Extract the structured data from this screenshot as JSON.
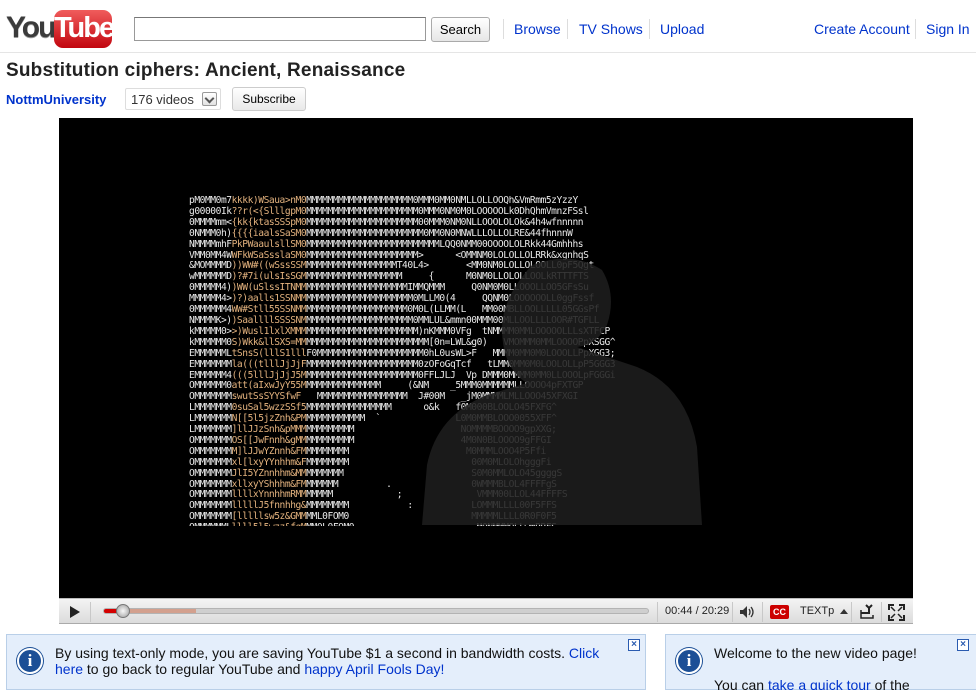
{
  "logo": {
    "you": "You",
    "tube": "Tube"
  },
  "search": {
    "value": "",
    "placeholder": "",
    "button_label": "Search"
  },
  "nav": {
    "browse": "Browse",
    "tv_shows": "TV Shows",
    "upload": "Upload",
    "create_account": "Create Account",
    "sign_in": "Sign In"
  },
  "video": {
    "title": "Substitution ciphers: Ancient, Renaissance",
    "channel": "NottmUniversity",
    "video_count": "176 videos",
    "subscribe_label": "Subscribe"
  },
  "player": {
    "current_time": "00:44",
    "duration": "20:29",
    "time_display": "00:44 / 20:29",
    "progress_fraction": 0.036,
    "buffered_fraction": 0.17,
    "cc_label": "CC",
    "quality_label": "TEXTp",
    "ascii_frame": [
      "pM0MM0m7kkkk)WSaua>nM0MMMMMMMMMMMMMMMMMMMM0MMM0MM0NMLLOLLOOQh&VmRmm5zYzzY",
      "g00000Ik??r(<{SlllgpM0MMMMMMMMMMMMMMMMMMMMM0MMM0NM0M0LOOOOOLk0DhQhmVmnzFSsl",
      "0MMMMmm<{kk{ktasSSSpM0MMMMMMMMMMMMMMMMMMMMM00MMM0NM0NLLOOOLOLOk&4h4wfnnnnn",
      "0NMMM0h){{{{iaalsSaSM0MMMMMMMMMMMMMMMMMMMMMM0MM0N0MNWLLLOLLOLRE&44fhnnnW",
      "NMMMMmhFPkPWaaulsllSM0MMMMMMMMMMMMMMMMMMMMMMMMMLQQ0NMM00OOOOLOLRkk44Gmhhhs",
      "VMM0MM4WWFkWSaSsslaSM0MMMMMMMMMMMMMMMMMMMMM>      <OMMNM0LOLOLLOLRRk&xgnhqS",
      "&MOMMMMD))WW#((wSssSSMMMMMMMMMMMMMMMMMMT40L4>       <MM0NM0LOLLOLOOLL0pF5Qgt",
      "wMMMMMMD)?#7i(ulsIsSGMMMMMMMMMMMMMMMMMMM     {      M0NM0LLOLOLLOOLkRTTTFTS",
      "0MMMMM4))WW(uSlssITNMMMMMMMMMMMMMMMMMMMMMIMMQMMM     Q0NM0M0LLOOOLLOO5GFsSu",
      "MMMMMM4>)?)aalls1SSNMMMMMMMMMMMMMMMMMMMMMM0MLLM0(4     QQNM0LOOOOOOLL0ggFssf",
      "0MMMMMM4WW#Stll55SSNMMMMMMMMMMMMMMMMMMMMM0M0L(LLMM(L   MM00MBLLOOLLLLL05GGsPf",
      "NMMMMK>))SaallllSSSSNMMMMMMMMMMMMMMMMMMMMM0MMLUL&mmn00MMM00MLLOOLLLLOOR#TGFLL",
      "kMMMMM0>>)Wusl1lxlXMMMMMMMMMMMMMMMMMMMMMMMM)nKMMM0VFg  tNMMMM0MMLOOOOOLLLsXTFCP",
      "kMMMMMM0S)Wkk&llSXS=MMMMMMMMMMMMMMMMMMMMMMMMM[0n=LWL&g0)   VMOMMM0MMLOOOOPpXSGG^",
      "EMMMMMMLtSnsS(lllS1lllF0MMMMMMMMMMMMMMMMMMMM0hL0usWL>F   MMMM0MM0M0LOOOLLPpXGG3;",
      "EMMMMMMMla(((tlllJjJjFMMMMMMMMMMMMMMMMMMMMM0zOFoGqTcf   tLMM0MM0M0LOOLOLLpP5GGG3",
      "EMMMMMM4(((5lllJjJjJ5MMMMMMMMMMMMMMMMMMMMMM0FFLJLJ  Vp DMMM0MMMM0MM0LLOOOLpFGGGi",
      "OMMMMMM0att(aIxwJyY55MMMMMMMMMMMMMMM     (&NM    _5MMM0MMMMMMLLOOOO4pFXTGP",
      "OMMMMMMMswutSsSYYSfwF   MMMMMMMMMMMMMMMMM  J#00M   _jM0MMMMLMLLOOO45XFXGI",
      "LMMMMMMM0suSal5wzzSSf5MMMMMMMMMMMMMMMM      o&k   f0M000BLOOLO45FXFG^",
      "LMMMMMMMN[[5l5jzZnh&PMMMMMMMMMMMM  `              L0M0MMBLOOO0055XFF^",
      "LMMMMMMM]llJJzSnh&pMMMMMMMMMMMM                    NOMMMMBOOOO9gpXXG;",
      "OMMMMMMMOS[[JwFnnh&gMMMMMMMMMMM                    4M0N0BLOOOO9gFFGI",
      "OMMMMMMMM]lJJwYZnnh&FMMMMMMMMM                      M0MMMLOOO4P5Ffi",
      "OMMMMMMMxl[lxyYYnhhm&FMMMMMMMM                       00M0MLOLOhgggFi",
      "OMMMMMMMJlI5YZnnhhm&MMMMMMMMM                        S0M0MMLOLO45ggggS",
      "OMMMMMMMxllxyYShhhm&FMMMMMMM         .               0WMMMBLOL4FFFFgS",
      "OMMMMMMMllllxYnnhhmRMMMMMMM            ;              VMMM00LLOL44FFFFS",
      "OMMMMMMMlllllJ5fnnhhg&MMMMMMMM           :           LOMMMLLLL00F5FFS",
      "OMMMMMMM[lllllsw5z&GMMMML0FOM0                       MMMMMLLLL0R0F0F5",
      "OMMMMMMLllll5l5wzz&fgMMM0L0FOM0                       M0NMMMOLLwmRRFS",
      "OMMMMMM5[lsslss]xJSgMMMMTTfOSqt                       L0WMMMLLmRmRRx",
      "LMMMMMM]SSIsS5lS1SMMMMMMM(M0S5j                        S0WMMWLLvmRRx",
      "LMMMMMM]uatSsIslSlSTMMMMM(Mn               s          0MMMMOMMLmmRRx",
      "LMMMMMMsSW(alst[llFMMMMMMM               (5          =M0MMBLLvmmRRx",
      "LMMMMMM0t))S(asIl1aSMMMMM                 5          0MM0WMBLvmRRx",
      "LMMMMMMM0SS)S(tuslsllFMMMM        ^                  VMM0WWMMOWmRRx",
      "OMMMMMMMM0S#?)Waallo1GMMMM        )                  MM0WMOMMmnwRRFx",
      "OMMMMMMMM0S#7)W(tuaSuJMMMMM        4                  FNNMMBMOMvURRx",
      "OMMMMMMMMK(??7WStaSafFMMMMMM;=V0M                     MWMMLOMMmmRRx",
      "QMMMMMMMMMSW?WSttaaaWhMMMMMMMMMMN                      0MMBMMMMOmmRRx",
      "B11B1J____________vIoY0:J::G^__^^                      !BDDD!O_;xx.-"
    ]
  },
  "notices": {
    "text_mode": {
      "line1_before": "By using text-only mode, you are saving YouTube $1 a second in bandwidth costs. ",
      "link_click_here": "Click here",
      "line_middle": " to go back to regular YouTube and ",
      "link_april": "happy April Fools Day!"
    },
    "welcome": {
      "title": "Welcome to the new video page!",
      "line2_before": "You can ",
      "link_tour": "take a quick tour",
      "line2_after": " of the"
    }
  },
  "icons": [
    "info-icon",
    "close-icon",
    "play-icon",
    "volume-icon",
    "popout-icon",
    "fullscreen-icon",
    "expand-icon"
  ],
  "colors": {
    "link": "#0033cc",
    "progress": "#d40000",
    "notice_bg": "#e4eefb",
    "brand_red": "#c2060f"
  }
}
